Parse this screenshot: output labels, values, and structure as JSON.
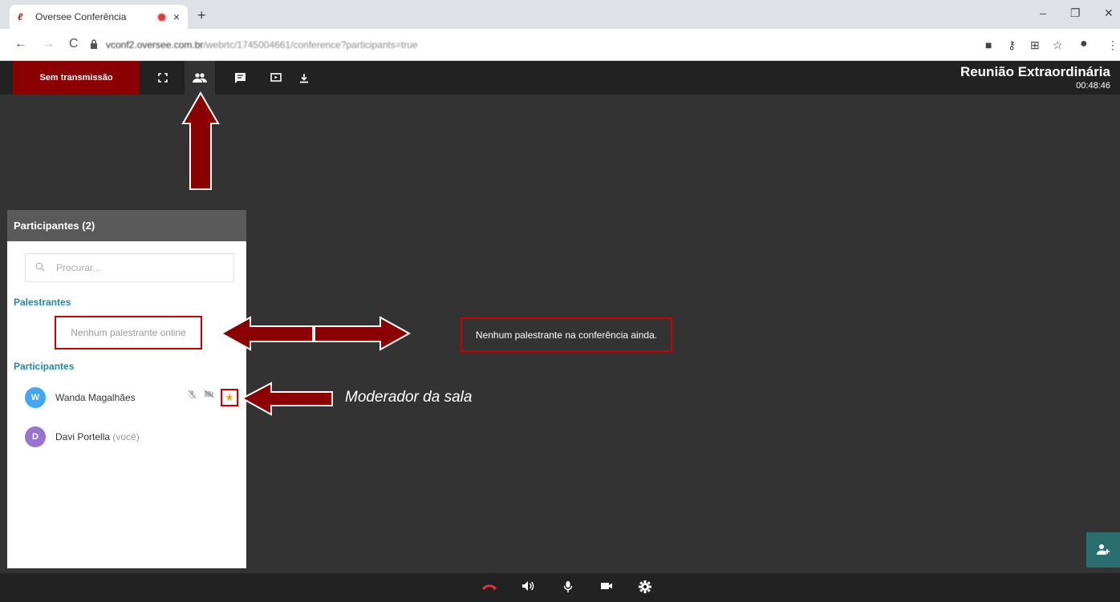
{
  "browser": {
    "tab_title": "Oversee Conferência",
    "tab_close": "×",
    "new_tab": "+",
    "url_host": "vconf2.oversee.com.br",
    "url_path": "/webrtc/1745004661/conference?participants=true",
    "nav_back": "←",
    "nav_forward": "→",
    "nav_reload": "C",
    "win_minimize": "–",
    "win_maximize": "❐",
    "win_close": "✕"
  },
  "toolbar": {
    "broadcast_label": "Sem transmissão",
    "meeting_title": "Reunião Extraordinária",
    "meeting_time": "00:48:46"
  },
  "panel": {
    "header": "Participantes (2)",
    "search_placeholder": "Procurar...",
    "speakers_heading": "Palestrantes",
    "no_speakers": "Nenhum palestrante online",
    "participants_heading": "Participantes",
    "participants": [
      {
        "initial": "W",
        "name": "Wanda Magalhães",
        "suffix": "",
        "color": "#42a5f5"
      },
      {
        "initial": "D",
        "name": "Davi Portella",
        "suffix": "(você)",
        "color": "#9575cd"
      }
    ]
  },
  "main": {
    "no_speaker_message": "Nenhum palestrante na conferência ainda.",
    "annotation_moderator": "Moderador da sala"
  },
  "colors": {
    "accent": "#8b0000",
    "annotation": "#c00000",
    "section_heading": "#1a8ca8",
    "star": "#f4a020"
  }
}
